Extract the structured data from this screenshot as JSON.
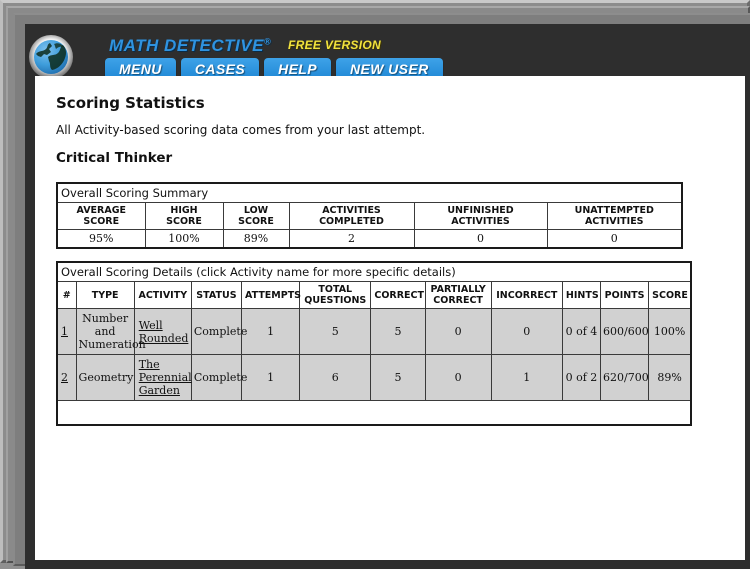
{
  "window": {
    "frame_color": "#8c8c8c",
    "app_background": "#2e2e2e"
  },
  "header": {
    "logo_name": "math-detective-globe-logo",
    "brand": "MATH DETECTIVE",
    "brand_registered": "®",
    "edition": "FREE VERSION",
    "brand_color": "#2f93e0",
    "edition_color": "#f2e33d",
    "button_color": "#1d86d4",
    "nav": [
      {
        "label": "MENU",
        "name": "nav-menu"
      },
      {
        "label": "CASES",
        "name": "nav-cases"
      },
      {
        "label": "HELP",
        "name": "nav-help"
      },
      {
        "label": "NEW USER",
        "name": "nav-new-user"
      }
    ]
  },
  "page": {
    "title": "Scoring Statistics",
    "subtitle": "All Activity-based scoring data comes from your last attempt.",
    "section_title": "Critical Thinker"
  },
  "summary": {
    "caption": "Overall Scoring Summary",
    "headers": [
      "AVERAGE SCORE",
      "HIGH SCORE",
      "LOW SCORE",
      "ACTIVITIES COMPLETED",
      "UNFINISHED ACTIVITIES",
      "UNATTEMPTED ACTIVITIES"
    ],
    "headers_lines": [
      [
        "AVERAGE",
        "SCORE"
      ],
      [
        "HIGH",
        "SCORE"
      ],
      [
        "LOW SCORE"
      ],
      [
        "ACTIVITIES",
        "COMPLETED"
      ],
      [
        "UNFINISHED",
        "ACTIVITIES"
      ],
      [
        "UNATTEMPTED",
        "ACTIVITIES"
      ]
    ],
    "values": [
      "95%",
      "100%",
      "89%",
      "2",
      "0",
      "0"
    ]
  },
  "details": {
    "caption": "Overall Scoring Details (click Activity name for more specific details)",
    "headers": [
      "#",
      "TYPE",
      "ACTIVITY",
      "STATUS",
      "ATTEMPTS",
      "TOTAL QUESTIONS",
      "CORRECT",
      "PARTIALLY CORRECT",
      "INCORRECT",
      "HINTS",
      "POINTS",
      "SCORE"
    ],
    "headers_lines": [
      [
        "#"
      ],
      [
        "TYPE"
      ],
      [
        "ACTIVITY"
      ],
      [
        "STATUS"
      ],
      [
        "ATTEMPTS"
      ],
      [
        "TOTAL",
        "QUESTIONS"
      ],
      [
        "CORRECT"
      ],
      [
        "PARTIALLY",
        "CORRECT"
      ],
      [
        "INCORRECT"
      ],
      [
        "HINTS"
      ],
      [
        "POINTS"
      ],
      [
        "SCORE"
      ]
    ],
    "rows": [
      {
        "num": "1",
        "type": "Number and Numeration",
        "activity": "Well Rounded",
        "status": "Complete",
        "attempts": "1",
        "total_questions": "5",
        "correct": "5",
        "partially_correct": "0",
        "incorrect": "0",
        "hints": "0 of 4",
        "points": "600/600",
        "score": "100%"
      },
      {
        "num": "2",
        "type": "Geometry",
        "activity": "The Perennial Garden",
        "status": "Complete",
        "attempts": "1",
        "total_questions": "6",
        "correct": "5",
        "partially_correct": "0",
        "incorrect": "1",
        "hints": "0 of 2",
        "points": "620/700",
        "score": "89%"
      }
    ],
    "row_background": "#d1d1d1"
  }
}
